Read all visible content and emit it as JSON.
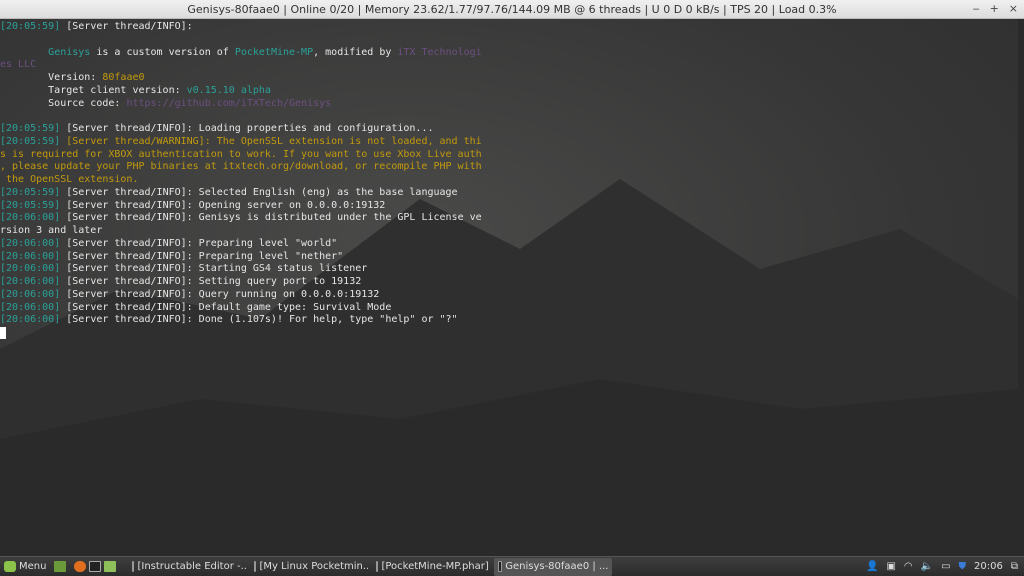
{
  "window": {
    "title": "Genisys-80faae0 | Online 0/20 | Memory 23.62/1.77/97.76/144.09 MB @ 6 threads | U 0 D 0 kB/s | TPS 20 | Load 0.3%",
    "buttons": [
      "‒",
      "+",
      "×"
    ]
  },
  "lines": [
    [
      [
        "ts",
        "[20:05:59] "
      ],
      [
        "",
        "[Server thread/INFO]:"
      ]
    ],
    [],
    [
      [
        "",
        "        "
      ],
      [
        "cy",
        "Genisys"
      ],
      [
        "",
        " is a custom version of "
      ],
      [
        "cy",
        "PocketMine-MP"
      ],
      [
        "",
        ", modified by "
      ],
      [
        "pu",
        "iTX Technologi"
      ]
    ],
    [
      [
        "pu",
        "es LLC"
      ]
    ],
    [
      [
        "",
        "        Version: "
      ],
      [
        "ye",
        "80faae0"
      ]
    ],
    [
      [
        "",
        "        Target client version: "
      ],
      [
        "cy",
        "v0.15.10 alpha"
      ]
    ],
    [
      [
        "",
        "        Source code: "
      ],
      [
        "pu",
        "https://github.com/iTXTech/Genisys"
      ]
    ],
    [],
    [
      [
        "ts",
        "[20:05:59] "
      ],
      [
        "",
        "[Server thread/INFO]: Loading properties and configuration..."
      ]
    ],
    [
      [
        "ts",
        "[20:05:59] "
      ],
      [
        "ye",
        "[Server thread/WARNING]: The OpenSSL extension is not loaded, and thi"
      ]
    ],
    [
      [
        "ye",
        "s is required for XBOX authentication to work. If you want to use Xbox Live auth"
      ]
    ],
    [
      [
        "ye",
        ", please update your PHP binaries at itxtech.org/download, or recompile PHP with"
      ]
    ],
    [
      [
        "ye",
        " the OpenSSL extension."
      ]
    ],
    [
      [
        "ts",
        "[20:05:59] "
      ],
      [
        "",
        "[Server thread/INFO]: Selected English (eng) as the base language"
      ]
    ],
    [
      [
        "ts",
        "[20:05:59] "
      ],
      [
        "",
        "[Server thread/INFO]: Opening server on 0.0.0.0:19132"
      ]
    ],
    [
      [
        "ts",
        "[20:06:00] "
      ],
      [
        "",
        "[Server thread/INFO]: Genisys is distributed under the GPL License ve"
      ]
    ],
    [
      [
        "",
        "rsion 3 and later"
      ]
    ],
    [
      [
        "ts",
        "[20:06:00] "
      ],
      [
        "",
        "[Server thread/INFO]: Preparing level \"world\""
      ]
    ],
    [
      [
        "ts",
        "[20:06:00] "
      ],
      [
        "",
        "[Server thread/INFO]: Preparing level \"nether\""
      ]
    ],
    [
      [
        "ts",
        "[20:06:00] "
      ],
      [
        "",
        "[Server thread/INFO]: Starting GS4 status listener"
      ]
    ],
    [
      [
        "ts",
        "[20:06:00] "
      ],
      [
        "",
        "[Server thread/INFO]: Setting query port to 19132"
      ]
    ],
    [
      [
        "ts",
        "[20:06:00] "
      ],
      [
        "",
        "[Server thread/INFO]: Query running on 0.0.0.0:19132"
      ]
    ],
    [
      [
        "ts",
        "[20:06:00] "
      ],
      [
        "",
        "[Server thread/INFO]: Default game type: Survival Mode"
      ]
    ],
    [
      [
        "ts",
        "[20:06:00] "
      ],
      [
        "",
        "[Server thread/INFO]: Done (1.107s)! For help, type \"help\" or \"?\""
      ]
    ]
  ],
  "taskbar": {
    "menu": "Menu",
    "tasks": [
      {
        "label": "[Instructable Editor -...",
        "icon": "firefox-icon"
      },
      {
        "label": "[My Linux Pocketmin...",
        "icon": "folder-icon"
      },
      {
        "label": "[PocketMine-MP.phar]",
        "icon": "folder-icon"
      },
      {
        "label": "Genisys-80faae0 | ...",
        "icon": "terminal-icon",
        "active": true
      }
    ],
    "clock": "20:06"
  }
}
